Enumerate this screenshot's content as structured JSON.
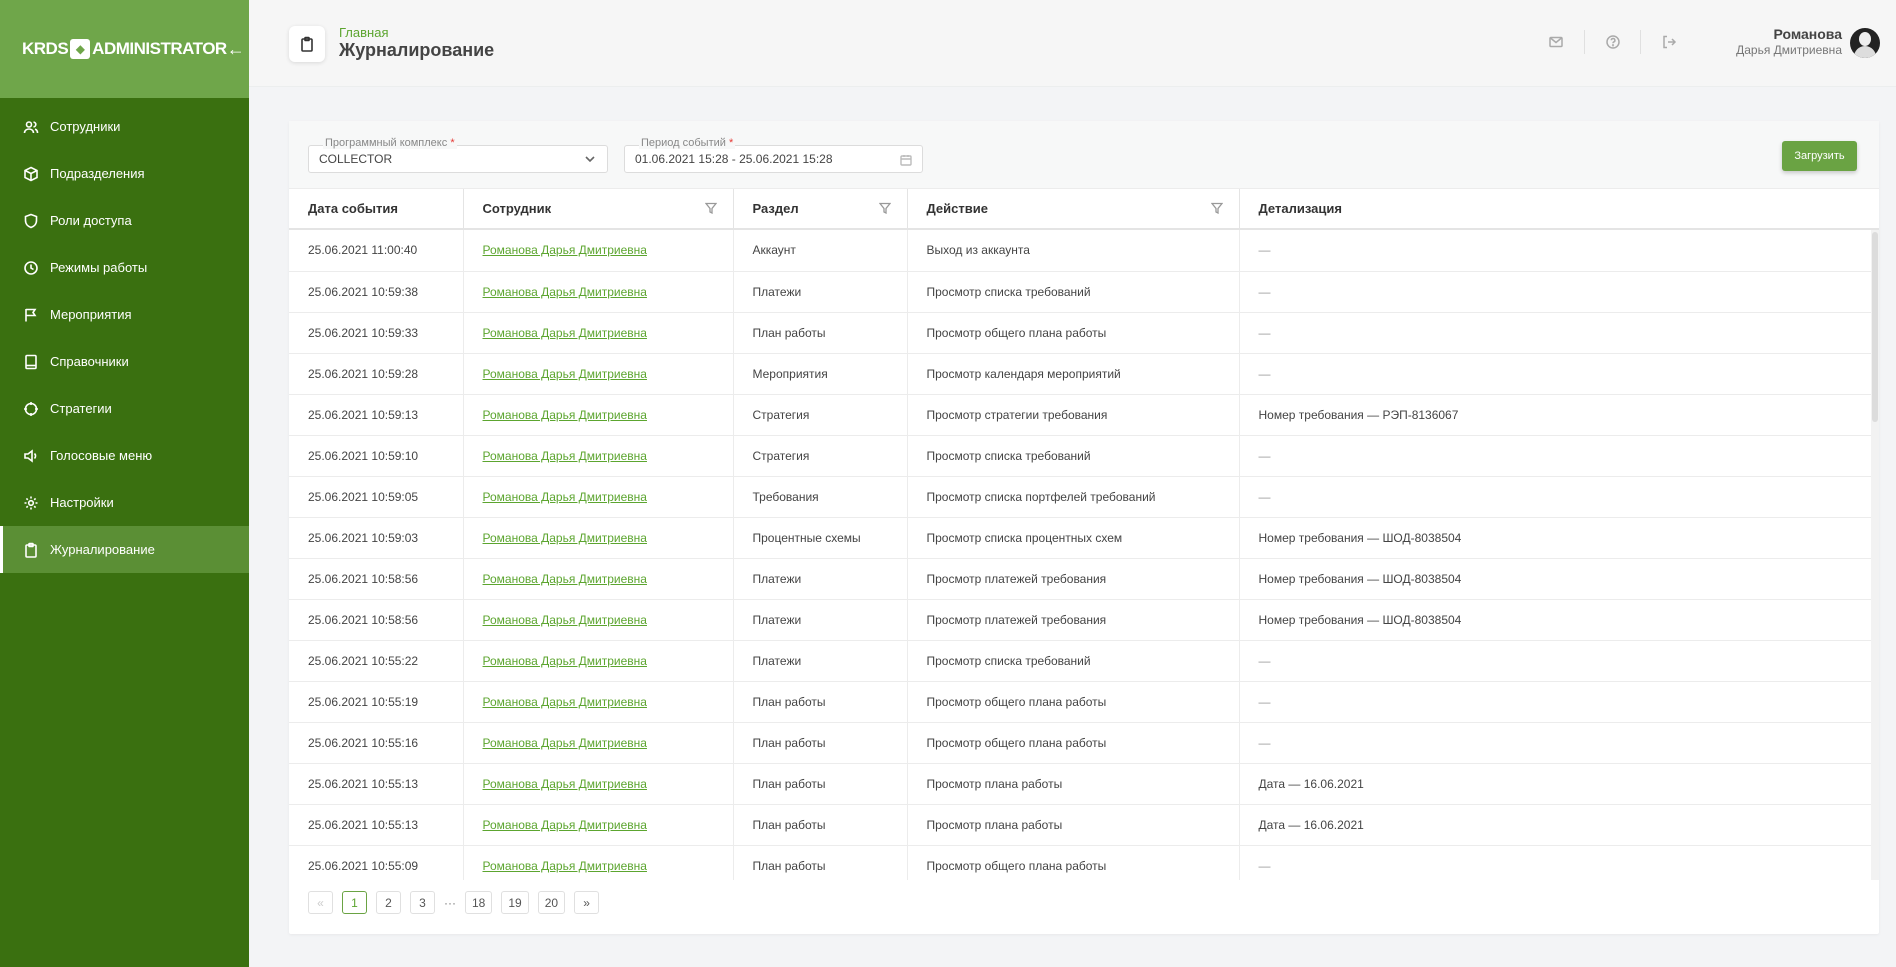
{
  "app": {
    "logo_left": "KRDS",
    "logo_right": "ADMINISTRATOR"
  },
  "sidebar": {
    "items": [
      {
        "label": "Сотрудники",
        "icon": "users-icon"
      },
      {
        "label": "Подразделения",
        "icon": "cube-icon"
      },
      {
        "label": "Роли доступа",
        "icon": "shield-icon"
      },
      {
        "label": "Режимы работы",
        "icon": "clock-icon"
      },
      {
        "label": "Мероприятия",
        "icon": "flag-icon"
      },
      {
        "label": "Справочники",
        "icon": "book-icon"
      },
      {
        "label": "Стратегии",
        "icon": "crosshair-icon"
      },
      {
        "label": "Голосовые меню",
        "icon": "speaker-icon"
      },
      {
        "label": "Настройки",
        "icon": "gear-icon"
      },
      {
        "label": "Журналирование",
        "icon": "clipboard-icon",
        "active": true
      }
    ]
  },
  "header": {
    "breadcrumb": "Главная",
    "title": "Журналирование",
    "user_last_name": "Романова",
    "user_first_names": "Дарья Дмитриевна"
  },
  "filters": {
    "complex_label": "Программный комплекс",
    "complex_value": "COLLECTOR",
    "period_label": "Период событий",
    "period_value": "01.06.2021 15:28 - 25.06.2021 15:28",
    "required_mark": "*",
    "load_button": "Загрузить"
  },
  "table": {
    "columns": [
      "Дата события",
      "Сотрудник",
      "Раздел",
      "Действие",
      "Детализация"
    ],
    "rows": [
      {
        "date": "25.06.2021 11:00:40",
        "employee": "Романова Дарья Дмитриевна",
        "section": "Аккаунт",
        "action": "Выход из аккаунта",
        "detail": "—"
      },
      {
        "date": "25.06.2021 10:59:38",
        "employee": "Романова Дарья Дмитриевна",
        "section": "Платежи",
        "action": "Просмотр списка требований",
        "detail": "—"
      },
      {
        "date": "25.06.2021 10:59:33",
        "employee": "Романова Дарья Дмитриевна",
        "section": "План работы",
        "action": "Просмотр общего плана работы",
        "detail": "—"
      },
      {
        "date": "25.06.2021 10:59:28",
        "employee": "Романова Дарья Дмитриевна",
        "section": "Мероприятия",
        "action": "Просмотр календаря мероприятий",
        "detail": "—"
      },
      {
        "date": "25.06.2021 10:59:13",
        "employee": "Романова Дарья Дмитриевна",
        "section": "Стратегия",
        "action": "Просмотр стратегии требования",
        "detail": "Номер требования — РЭП-8136067"
      },
      {
        "date": "25.06.2021 10:59:10",
        "employee": "Романова Дарья Дмитриевна",
        "section": "Стратегия",
        "action": "Просмотр списка требований",
        "detail": "—"
      },
      {
        "date": "25.06.2021 10:59:05",
        "employee": "Романова Дарья Дмитриевна",
        "section": "Требования",
        "action": "Просмотр списка портфелей требований",
        "detail": "—"
      },
      {
        "date": "25.06.2021 10:59:03",
        "employee": "Романова Дарья Дмитриевна",
        "section": "Процентные схемы",
        "action": "Просмотр списка процентных схем",
        "detail": "Номер требования — ШОД-8038504"
      },
      {
        "date": "25.06.2021 10:58:56",
        "employee": "Романова Дарья Дмитриевна",
        "section": "Платежи",
        "action": "Просмотр платежей требования",
        "detail": "Номер требования — ШОД-8038504"
      },
      {
        "date": "25.06.2021 10:58:56",
        "employee": "Романова Дарья Дмитриевна",
        "section": "Платежи",
        "action": "Просмотр платежей требования",
        "detail": "Номер требования — ШОД-8038504"
      },
      {
        "date": "25.06.2021 10:55:22",
        "employee": "Романова Дарья Дмитриевна",
        "section": "Платежи",
        "action": "Просмотр списка требований",
        "detail": "—"
      },
      {
        "date": "25.06.2021 10:55:19",
        "employee": "Романова Дарья Дмитриевна",
        "section": "План работы",
        "action": "Просмотр общего плана работы",
        "detail": "—"
      },
      {
        "date": "25.06.2021 10:55:16",
        "employee": "Романова Дарья Дмитриевна",
        "section": "План работы",
        "action": "Просмотр общего плана работы",
        "detail": "—"
      },
      {
        "date": "25.06.2021 10:55:13",
        "employee": "Романова Дарья Дмитриевна",
        "section": "План работы",
        "action": "Просмотр плана работы",
        "detail": "Дата — 16.06.2021"
      },
      {
        "date": "25.06.2021 10:55:13",
        "employee": "Романова Дарья Дмитриевна",
        "section": "План работы",
        "action": "Просмотр плана работы",
        "detail": "Дата — 16.06.2021"
      },
      {
        "date": "25.06.2021 10:55:09",
        "employee": "Романова Дарья Дмитриевна",
        "section": "План работы",
        "action": "Просмотр общего плана работы",
        "detail": "—"
      }
    ]
  },
  "pagination": {
    "prev": "«",
    "next": "»",
    "pages": [
      "1",
      "2",
      "3"
    ],
    "ellipsis": "···",
    "last_pages": [
      "18",
      "19",
      "20"
    ],
    "current": "1"
  },
  "colors": {
    "sidebar_bg": "#3a7010",
    "sidebar_head_bg": "#6fa64a",
    "accent": "#5ca52f",
    "button": "#6aa343"
  }
}
